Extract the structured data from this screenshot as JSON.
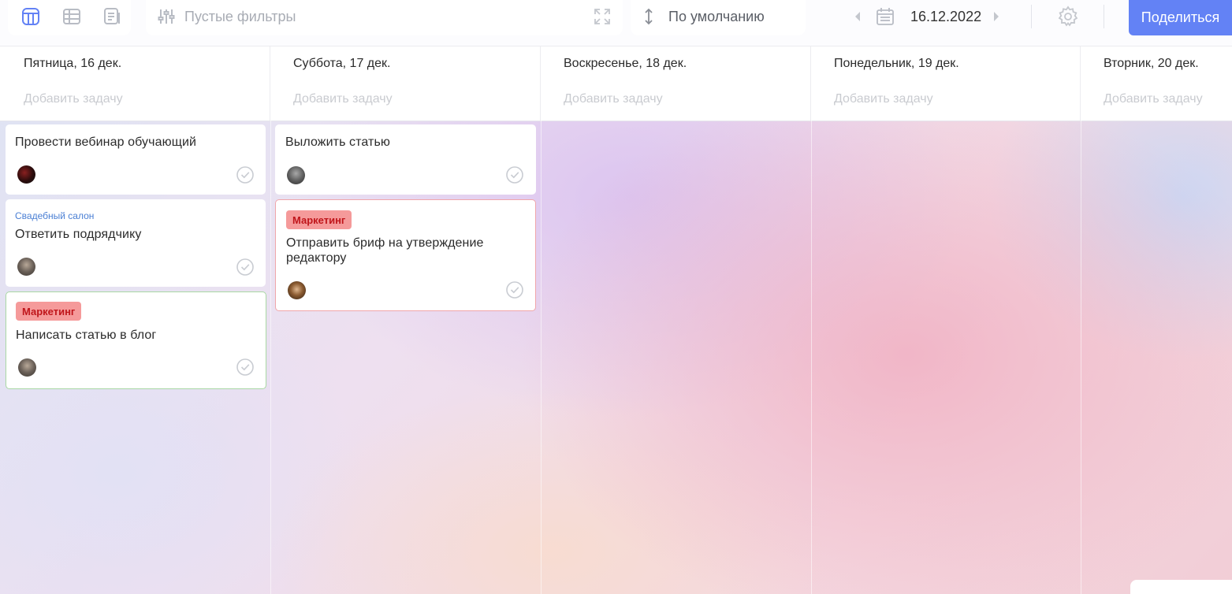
{
  "toolbar": {
    "view_buttons": [
      {
        "name": "board-view-icon",
        "active": true
      },
      {
        "name": "table-view-icon",
        "active": false
      },
      {
        "name": "list-view-icon",
        "active": false
      }
    ],
    "filters_label": "Пустые фильтры",
    "sort_label": "По умолчанию",
    "date": "16.12.2022",
    "share_label": "Поделиться",
    "accent_color": "#6382f5"
  },
  "days": [
    {
      "title": "Пятница, 16 дек.",
      "add_task": "Добавить задачу"
    },
    {
      "title": "Суббота, 17 дек.",
      "add_task": "Добавить задачу"
    },
    {
      "title": "Воскресенье, 18 дек.",
      "add_task": "Добавить задачу"
    },
    {
      "title": "Понедельник, 19 дек.",
      "add_task": "Добавить задачу"
    },
    {
      "title": "Вторник, 20 дек.",
      "add_task": "Добавить задачу"
    }
  ],
  "cards": [
    {
      "day": 0,
      "title": "Провести вебинар обучающий",
      "project": "",
      "tag": "",
      "done": false
    },
    {
      "day": 0,
      "title": "Ответить подрядчику",
      "project": "Свадебный салон",
      "tag": "",
      "done": false
    },
    {
      "day": 0,
      "title": "Написать статью в блог",
      "project": "",
      "tag": "Маркетинг",
      "done": false
    },
    {
      "day": 1,
      "title": "Выложить статью",
      "project": "",
      "tag": "",
      "done": false
    },
    {
      "day": 1,
      "title": "Отправить бриф на утверждение редактору",
      "project": "",
      "tag": "Маркетинг",
      "done": false
    }
  ],
  "tag_colors": {
    "background": "#f59a9a",
    "text": "#c0161b"
  }
}
